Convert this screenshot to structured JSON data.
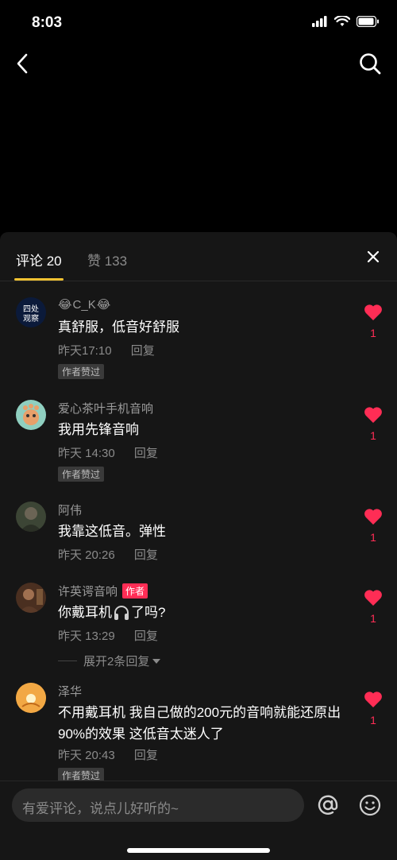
{
  "status": {
    "time": "8:03"
  },
  "tabs": {
    "comments": "评论 20",
    "likes": "赞 133"
  },
  "comments": [
    {
      "user_pre": "😂",
      "user": "C_K",
      "user_post": "😂",
      "text": "真舒服，低音好舒服",
      "time": "昨天17:10",
      "reply": "回复",
      "badge": "作者赞过",
      "likes": "1"
    },
    {
      "user": "爱心茶叶手机音响",
      "text": "我用先锋音响",
      "time": "昨天 14:30",
      "reply": "回复",
      "badge": "作者赞过",
      "likes": "1"
    },
    {
      "user": "阿伟",
      "text": "我靠这低音。弹性",
      "time": "昨天 20:26",
      "reply": "回复",
      "likes": "1"
    },
    {
      "user": "许英谔音响",
      "author_tag": "作者",
      "text_a": "你戴耳机",
      "text_b": "了吗?",
      "time": "昨天 13:29",
      "reply": "回复",
      "likes": "1"
    },
    {
      "user": "泽华",
      "text": "不用戴耳机 我自己做的200元的音响就能还原出90%的效果 这低音太迷人了",
      "time": "昨天 20:43",
      "reply": "回复",
      "badge": "作者赞过",
      "likes": "1"
    }
  ],
  "expand_replies": "展开2条回复",
  "input": {
    "placeholder": "有爱评论，说点儿好听的~"
  },
  "icons": [
    "back-icon",
    "search-icon",
    "close-icon",
    "heart-icon",
    "headphones-icon",
    "at-icon",
    "emoji-icon"
  ],
  "colors": {
    "accent": "#f1c232",
    "like": "#ff2d55",
    "panel": "#161616"
  }
}
